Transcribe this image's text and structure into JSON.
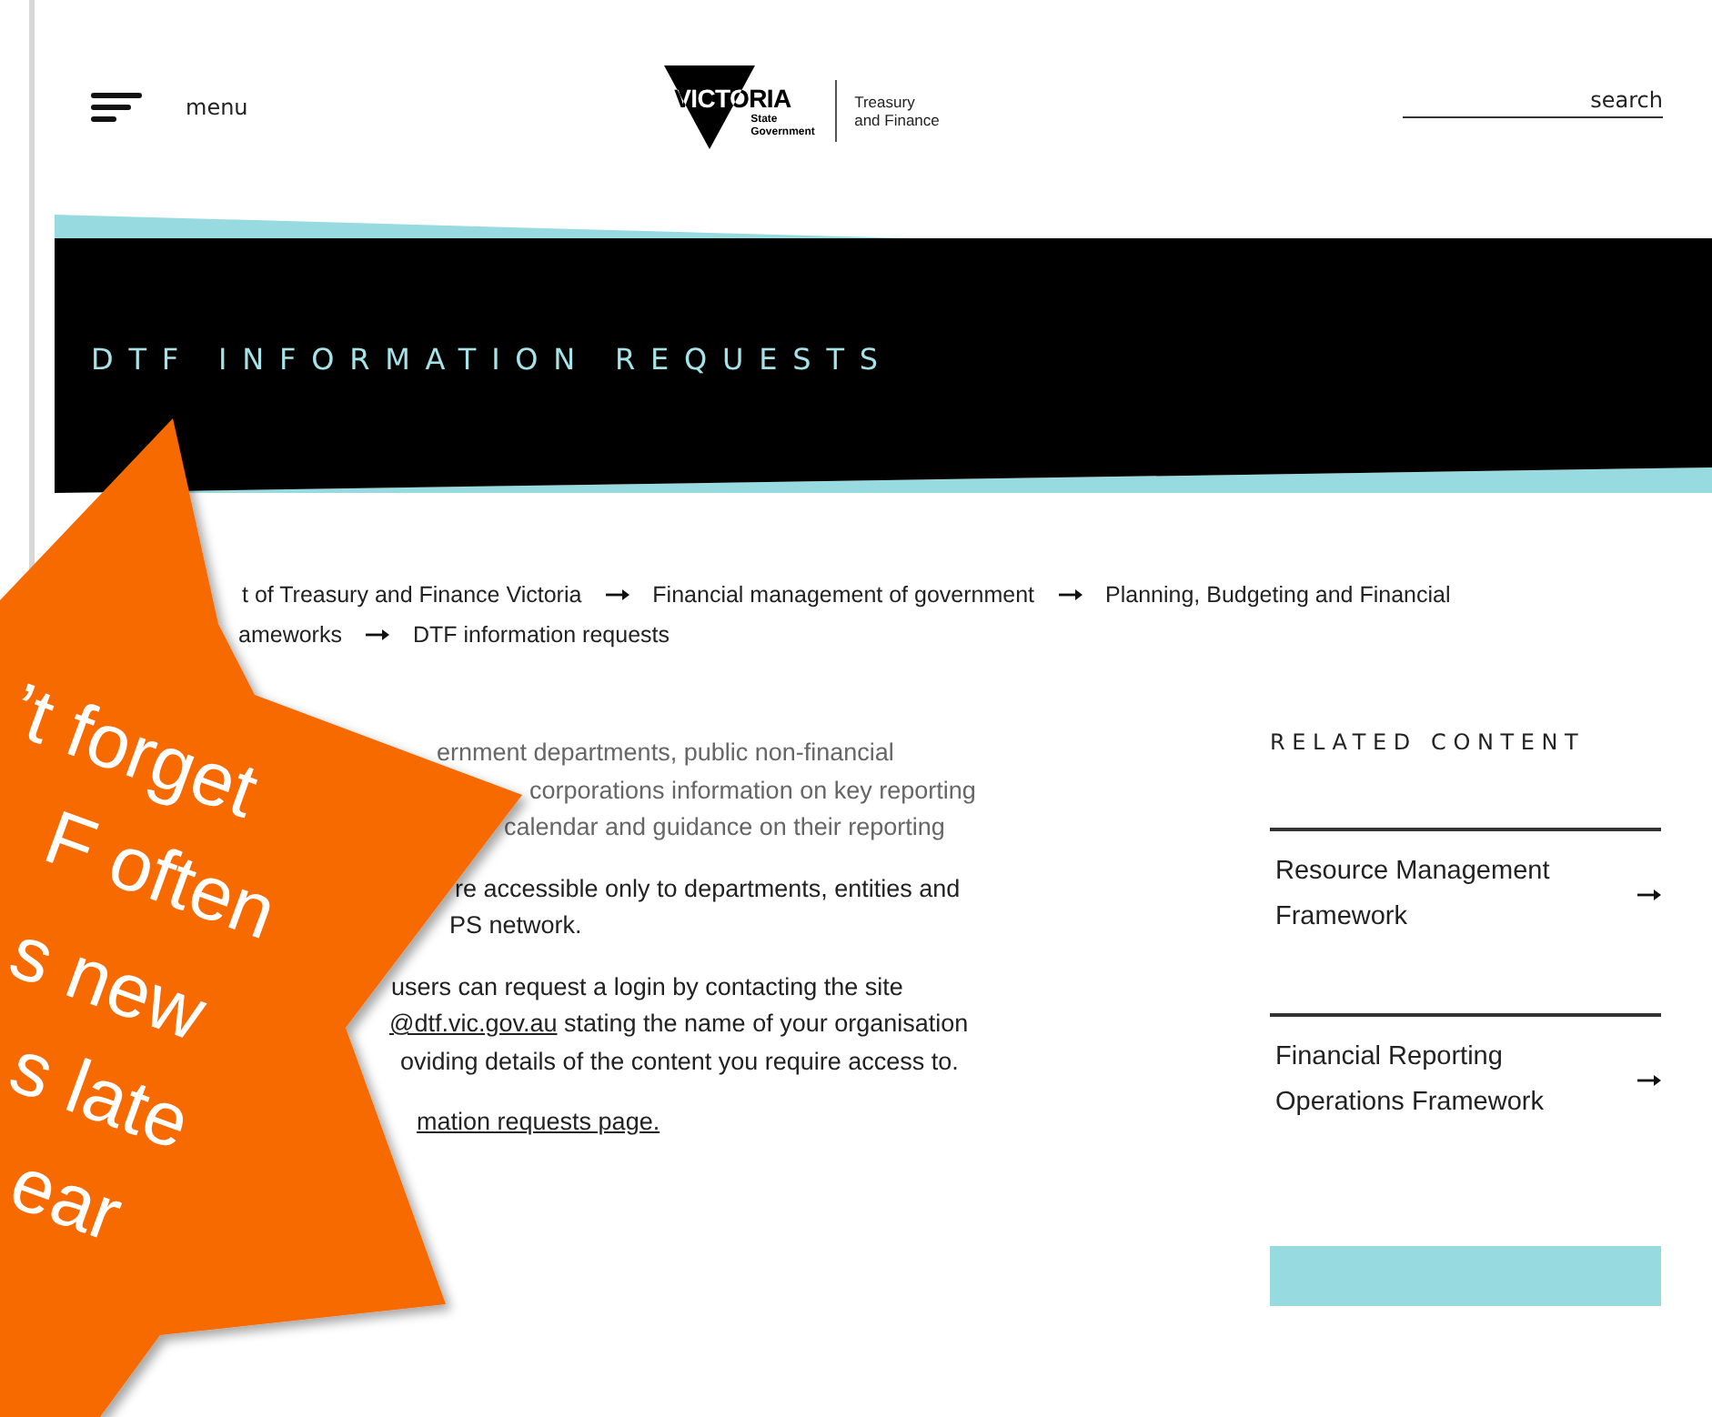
{
  "header": {
    "menu_label": "menu",
    "logo": {
      "wordmark": "VICTORIA",
      "sub": [
        "State",
        "Government"
      ],
      "department": [
        "Treasury",
        "and Finance"
      ]
    },
    "search": {
      "placeholder": "search"
    }
  },
  "banner": {
    "title": "DTF INFORMATION REQUESTS"
  },
  "breadcrumb": {
    "lines": [
      [
        {
          "label": "t of Treasury and Finance Victoria"
        },
        {
          "label": "Financial management of government"
        },
        {
          "label": "Planning, Budgeting and Financial"
        }
      ],
      [
        {
          "label": "ameworks"
        },
        {
          "label": "DTF information requests"
        }
      ]
    ]
  },
  "body": {
    "paragraphs": [
      {
        "muted": true,
        "lines": [
          [
            {
              "kind": "text",
              "text": "ernment departments, public non-financial"
            }
          ],
          [
            {
              "kind": "text",
              "text": "corporations information on key reporting"
            }
          ],
          [
            {
              "kind": "text",
              "text": "calendar and guidance on their reporting"
            }
          ]
        ]
      },
      {
        "muted": false,
        "lines": [
          [
            {
              "kind": "text",
              "text": "re accessible only to departments, entities and"
            }
          ],
          [
            {
              "kind": "text",
              "text": "PS network."
            }
          ]
        ]
      },
      {
        "muted": false,
        "lines": [
          [
            {
              "kind": "text",
              "text": "users can request a login by contacting the site"
            }
          ],
          [
            {
              "kind": "link",
              "text": "@dtf.vic.gov.au"
            },
            {
              "kind": "text",
              "text": " stating the name of your organisation"
            }
          ],
          [
            {
              "kind": "text",
              "text": "oviding details of the content you require access to."
            }
          ]
        ]
      },
      {
        "muted": false,
        "lines": [
          [
            {
              "kind": "link",
              "text": "mation requests page."
            }
          ]
        ]
      }
    ]
  },
  "related": {
    "heading": "RELATED CONTENT",
    "items": [
      {
        "lines": [
          "Resource Management",
          "Framework"
        ]
      },
      {
        "lines": [
          "Financial Reporting",
          "Operations Framework"
        ]
      }
    ]
  },
  "callout": {
    "lines": [
      "’t forget",
      "F often",
      "s new",
      "s late",
      "ear"
    ]
  }
}
